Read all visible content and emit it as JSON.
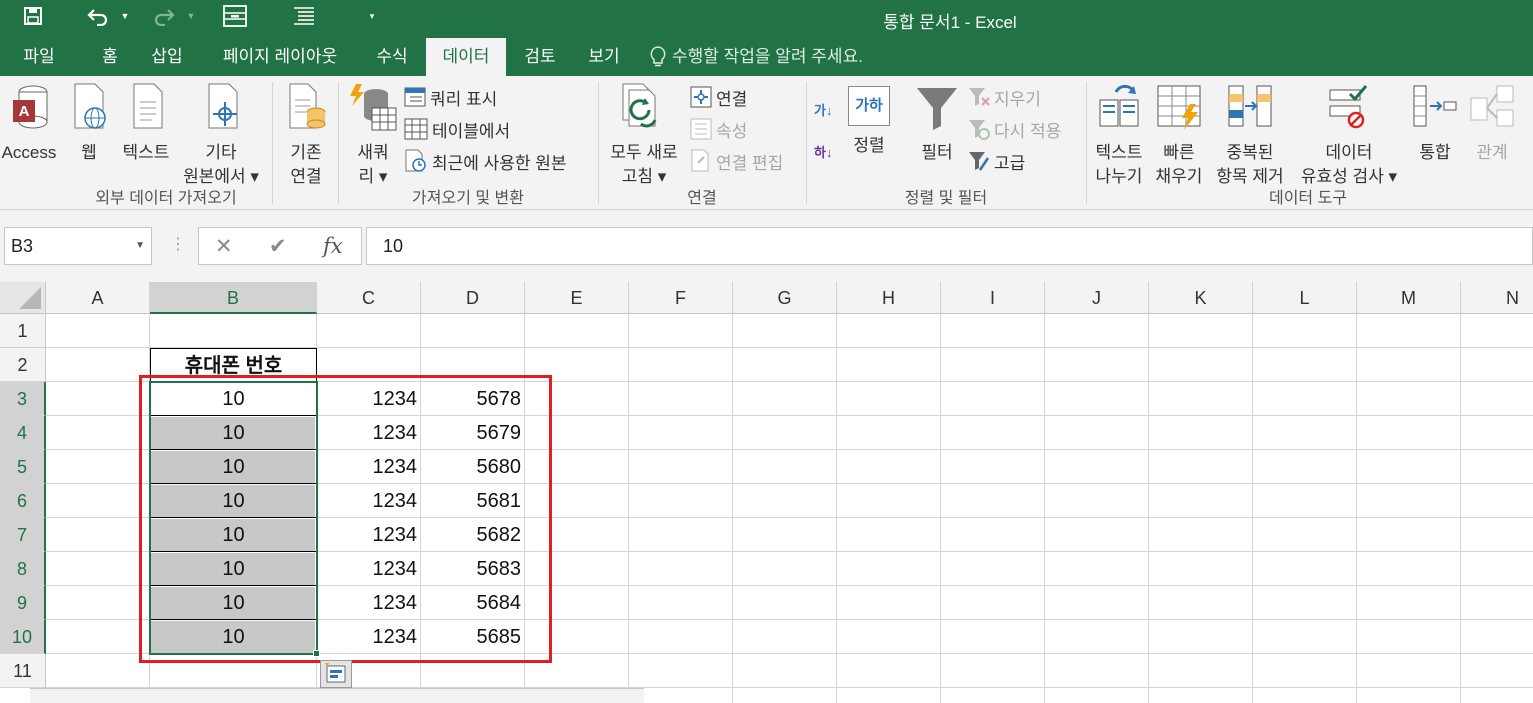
{
  "window": {
    "title": "통합 문서1 - Excel",
    "colors": {
      "brand": "#217346",
      "ribbon_bg": "#f3f3f3",
      "highlight_box": "#e02020",
      "selected_fill": "#c8c8c8"
    }
  },
  "qat": {
    "items": [
      "save-icon",
      "undo-icon",
      "redo-icon",
      "form-icon",
      "list-icon",
      "customize-icon"
    ]
  },
  "tabs": [
    {
      "label": "파일",
      "active": false
    },
    {
      "label": "홈",
      "active": false
    },
    {
      "label": "삽입",
      "active": false
    },
    {
      "label": "페이지 레이아웃",
      "active": false
    },
    {
      "label": "수식",
      "active": false
    },
    {
      "label": "데이터",
      "active": true
    },
    {
      "label": "검토",
      "active": false
    },
    {
      "label": "보기",
      "active": false
    }
  ],
  "tell_me": "수행할 작업을 알려 주세요.",
  "ribbon": {
    "get_external": {
      "label": "외부 데이터 가져오기",
      "access": "Access",
      "web": "웹",
      "text": "텍스트",
      "other_line1": "기타",
      "other_line2": "원본에서 ▾",
      "existing_line1": "기존",
      "existing_line2": "연결"
    },
    "get_transform": {
      "label": "가져오기 및 변환",
      "new_query_line1": "새쿼",
      "new_query_line2": "리 ▾",
      "show_queries": "쿼리 표시",
      "from_table": "테이블에서",
      "recent_sources": "최근에 사용한 원본"
    },
    "connections": {
      "label": "연결",
      "refresh_line1": "모두 새로",
      "refresh_line2": "고침 ▾",
      "connections": "연결",
      "properties": "속성",
      "edit_links": "연결 편집"
    },
    "sort_filter": {
      "label": "정렬 및 필터",
      "sort": "정렬",
      "filter": "필터",
      "clear": "지우기",
      "reapply": "다시 적용",
      "advanced": "고급",
      "sort_az_icon": "가↓",
      "sort_za_icon": "하↓",
      "sort_dialog_icon": "가하"
    },
    "data_tools": {
      "label": "데이터 도구",
      "text_to_columns_line1": "텍스트",
      "text_to_columns_line2": "나누기",
      "flash_fill_line1": "빠른",
      "flash_fill_line2": "채우기",
      "remove_dup_line1": "중복된",
      "remove_dup_line2": "항목 제거",
      "validation_line1": "데이터",
      "validation_line2": "유효성 검사 ▾",
      "consolidate": "통합",
      "relationships": "관계"
    }
  },
  "formula_bar": {
    "name_box": "B3",
    "cancel": "✕",
    "enter": "✔",
    "fx": "fx",
    "content": "10"
  },
  "sheet": {
    "columns": [
      "A",
      "B",
      "C",
      "D",
      "E",
      "F",
      "G",
      "H",
      "I",
      "J",
      "K",
      "L",
      "M",
      "N"
    ],
    "selected_column": "B",
    "rows": [
      "1",
      "2",
      "3",
      "4",
      "5",
      "6",
      "7",
      "8",
      "9",
      "10",
      "11"
    ],
    "selected_rows": [
      "3",
      "4",
      "5",
      "6",
      "7",
      "8",
      "9",
      "10"
    ],
    "header_cell": "휴대폰 번호",
    "data_rows": [
      {
        "b": "10",
        "c": "1234",
        "d": "5678"
      },
      {
        "b": "10",
        "c": "1234",
        "d": "5679"
      },
      {
        "b": "10",
        "c": "1234",
        "d": "5680"
      },
      {
        "b": "10",
        "c": "1234",
        "d": "5681"
      },
      {
        "b": "10",
        "c": "1234",
        "d": "5682"
      },
      {
        "b": "10",
        "c": "1234",
        "d": "5683"
      },
      {
        "b": "10",
        "c": "1234",
        "d": "5684"
      },
      {
        "b": "10",
        "c": "1234",
        "d": "5685"
      }
    ]
  }
}
